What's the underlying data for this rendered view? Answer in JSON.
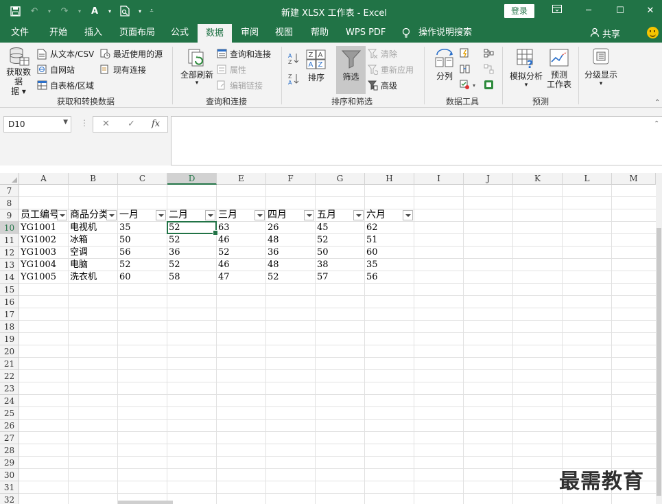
{
  "window": {
    "title": "新建 XLSX 工作表  -  Excel",
    "login": "登录",
    "share": "共享"
  },
  "tabs": [
    "文件",
    "开始",
    "插入",
    "页面布局",
    "公式",
    "数据",
    "审阅",
    "视图",
    "帮助",
    "WPS PDF",
    "操作说明搜索"
  ],
  "active_tab": "数据",
  "ribbon": {
    "get_data": {
      "label": "获取数据",
      "label2": "据",
      "from_text": "从文本/CSV",
      "from_web": "自网站",
      "from_table": "自表格/区域",
      "recent": "最近使用的源",
      "existing": "现有连接",
      "group": "获取和转换数据"
    },
    "queries": {
      "refresh": "全部刷新",
      "queries_conn": "查询和连接",
      "properties": "属性",
      "edit_links": "编辑链接",
      "group": "查询和连接"
    },
    "sort_filter": {
      "sort": "排序",
      "filter": "筛选",
      "clear": "清除",
      "reapply": "重新应用",
      "advanced": "高级",
      "group": "排序和筛选"
    },
    "data_tools": {
      "split": "分列",
      "group": "数据工具"
    },
    "forecast": {
      "whatif": "模拟分析",
      "sheet": "预测",
      "sheet2": "工作表",
      "group": "预测"
    },
    "outline": {
      "label": "分级显示"
    }
  },
  "formula_bar": {
    "name_box": "D10",
    "fx": "fx",
    "value": ""
  },
  "sheet": {
    "columns": [
      "A",
      "B",
      "C",
      "D",
      "E",
      "F",
      "G",
      "H",
      "I",
      "J",
      "K",
      "L",
      "M"
    ],
    "selected_column": "D",
    "selected_row": "10",
    "rows": [
      "7",
      "8",
      "9",
      "10",
      "11",
      "12",
      "13",
      "14",
      "15",
      "16",
      "17",
      "18",
      "19",
      "20",
      "21",
      "22",
      "23",
      "24",
      "25",
      "26",
      "27",
      "28",
      "29",
      "30",
      "31",
      "32"
    ],
    "headers": [
      "员工编号",
      "商品分类",
      "一月",
      "二月",
      "三月",
      "四月",
      "五月",
      "六月"
    ],
    "data": [
      [
        "YG1001",
        "电视机",
        "35",
        "52",
        "63",
        "26",
        "45",
        "62"
      ],
      [
        "YG1002",
        "冰箱",
        "50",
        "52",
        "46",
        "48",
        "52",
        "51"
      ],
      [
        "YG1003",
        "空调",
        "56",
        "36",
        "52",
        "36",
        "50",
        "60"
      ],
      [
        "YG1004",
        "电脑",
        "52",
        "52",
        "46",
        "48",
        "38",
        "35"
      ],
      [
        "YG1005",
        "洗衣机",
        "60",
        "58",
        "47",
        "52",
        "57",
        "56"
      ]
    ]
  },
  "watermark": "最需教育"
}
